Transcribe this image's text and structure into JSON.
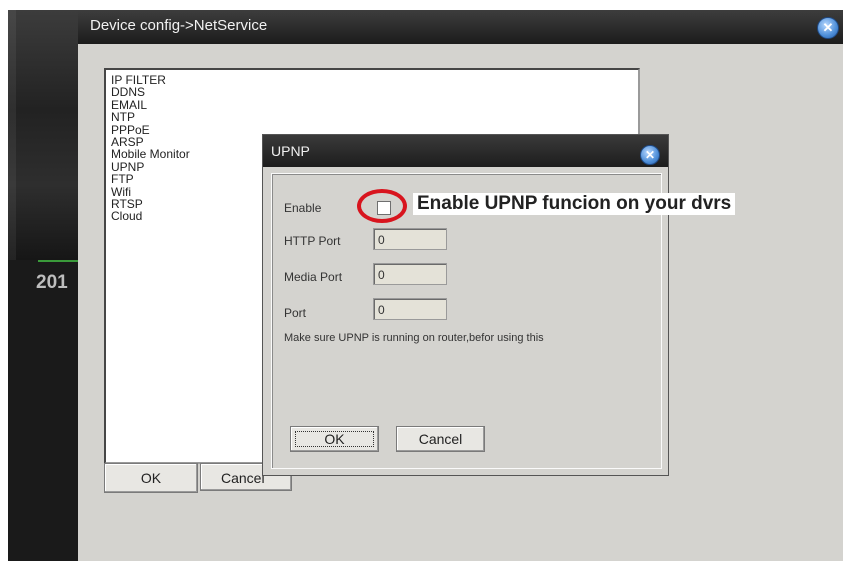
{
  "camera": {
    "timestamp_partial": "201"
  },
  "main_window": {
    "title": "Device config->NetService",
    "close_symbol": "✕",
    "services": [
      "IP FILTER",
      "DDNS",
      "EMAIL",
      "NTP",
      "PPPoE",
      "ARSP",
      "Mobile Monitor",
      "UPNP",
      "FTP",
      "Wifi",
      "RTSP",
      "Cloud"
    ],
    "ok_label": "OK",
    "cancel_label": "Cancel"
  },
  "upnp_dialog": {
    "title": "UPNP",
    "close_symbol": "✕",
    "enable_label": "Enable",
    "enable_checked": false,
    "http_port_label": "HTTP Port",
    "http_port_value": "0",
    "media_port_label": "Media Port",
    "media_port_value": "0",
    "port_label": "Port",
    "port_value": "0",
    "note": "Make sure UPNP is running on router,befor using this",
    "ok_label": "OK",
    "cancel_label": "Cancel"
  },
  "annotation": {
    "text": "Enable UPNP funcion on your dvrs",
    "highlight_color": "#d8141e"
  }
}
